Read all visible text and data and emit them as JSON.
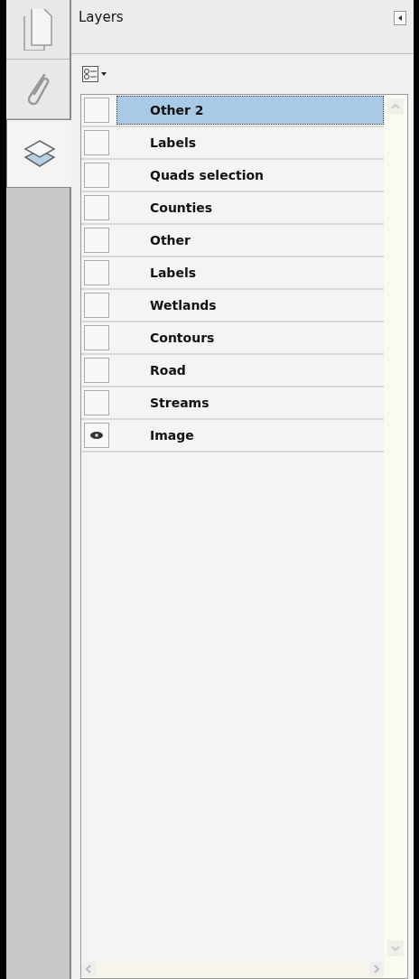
{
  "side_tabs": [
    {
      "kind": "pages",
      "selected": false
    },
    {
      "kind": "attachments",
      "selected": false
    },
    {
      "kind": "layers",
      "selected": true
    }
  ],
  "panel": {
    "title": "Layers"
  },
  "layers": [
    {
      "name": "Other 2",
      "visible": false,
      "selected": true
    },
    {
      "name": "Labels",
      "visible": false,
      "selected": false
    },
    {
      "name": "Quads selection",
      "visible": false,
      "selected": false
    },
    {
      "name": "Counties",
      "visible": false,
      "selected": false
    },
    {
      "name": "Other",
      "visible": false,
      "selected": false
    },
    {
      "name": "Labels",
      "visible": false,
      "selected": false
    },
    {
      "name": "Wetlands",
      "visible": false,
      "selected": false
    },
    {
      "name": "Contours",
      "visible": false,
      "selected": false
    },
    {
      "name": "Road",
      "visible": false,
      "selected": false
    },
    {
      "name": "Streams",
      "visible": false,
      "selected": false
    },
    {
      "name": "Image",
      "visible": true,
      "selected": false
    }
  ]
}
